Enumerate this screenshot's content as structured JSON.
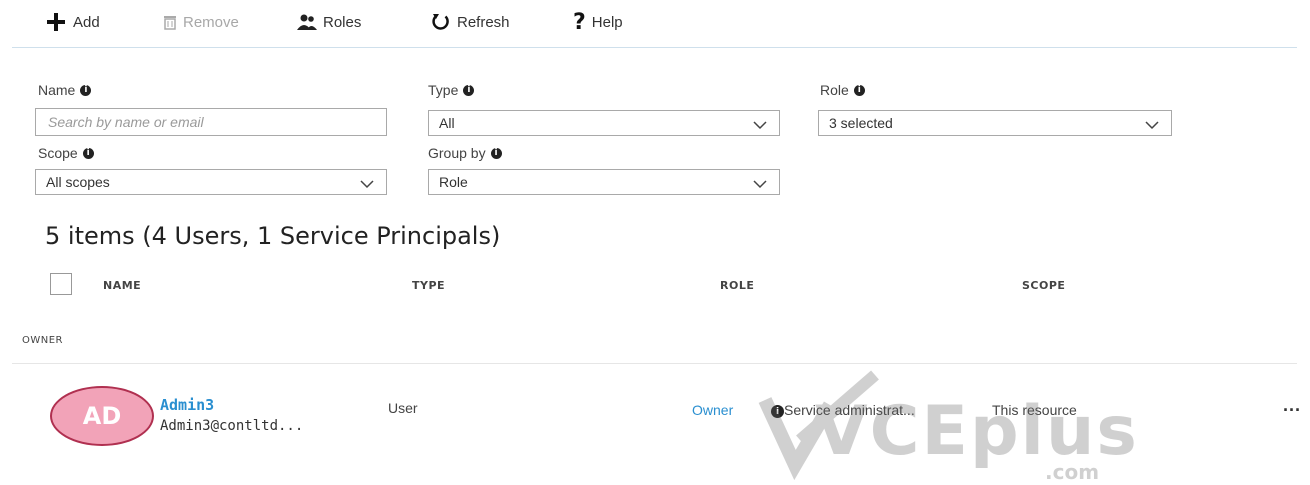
{
  "toolbar": {
    "add_label": "Add",
    "remove_label": "Remove",
    "roles_label": "Roles",
    "refresh_label": "Refresh",
    "help_label": "Help"
  },
  "filters": {
    "name_label": "Name",
    "name_placeholder": "Search by name or email",
    "type_label": "Type",
    "type_value": "All",
    "role_label": "Role",
    "role_value": "3 selected",
    "scope_label": "Scope",
    "scope_value": "All scopes",
    "groupby_label": "Group by",
    "groupby_value": "Role"
  },
  "summary": "5 items (4 Users, 1 Service Principals)",
  "columns": {
    "name": "NAME",
    "type": "TYPE",
    "role": "ROLE",
    "scope": "SCOPE"
  },
  "group_header": "OWNER",
  "rows": [
    {
      "avatar_initials": "AD",
      "name": "Admin3",
      "email": "Admin3@contltd...",
      "type": "User",
      "role": "Owner",
      "role_extra": "Service administrat...",
      "scope": "This resource",
      "more": "···"
    }
  ],
  "watermark": {
    "main": "VCEplus",
    "sub": ".com"
  },
  "colors": {
    "accent": "#2a8fd0",
    "avatar_bg": "#f2a3b8",
    "avatar_border": "#b03050",
    "separator": "#cfe0ec"
  }
}
